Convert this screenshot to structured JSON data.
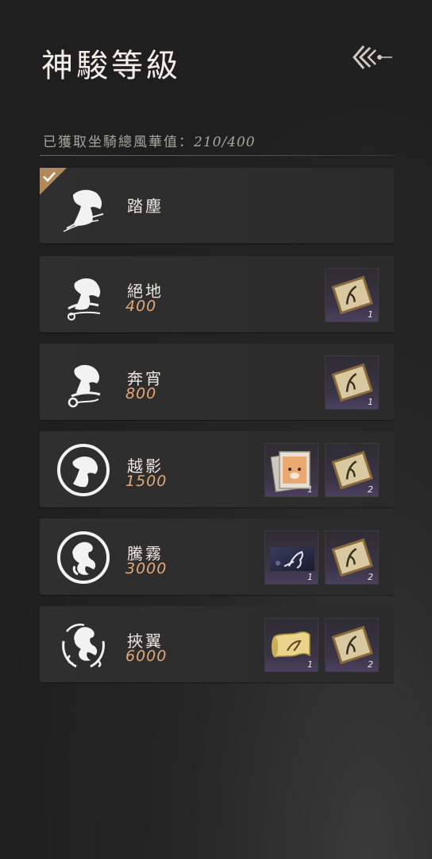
{
  "header": {
    "title": "神駿等級"
  },
  "progress": {
    "label": "已獲取坐騎總風華值：",
    "value": "210/400"
  },
  "levels": [
    {
      "name": "踏塵",
      "requirement": "",
      "achieved": true,
      "rewards": []
    },
    {
      "name": "絕地",
      "requirement": "400",
      "achieved": false,
      "rewards": [
        {
          "icon": "horse-scroll-icon",
          "count": "1"
        }
      ]
    },
    {
      "name": "奔宵",
      "requirement": "800",
      "achieved": false,
      "rewards": [
        {
          "icon": "horse-scroll-icon",
          "count": "1"
        }
      ]
    },
    {
      "name": "越影",
      "requirement": "1500",
      "achieved": false,
      "rewards": [
        {
          "icon": "fox-card-icon",
          "count": "1"
        },
        {
          "icon": "horse-scroll-icon",
          "count": "2"
        }
      ]
    },
    {
      "name": "騰霧",
      "requirement": "3000",
      "achieved": false,
      "rewards": [
        {
          "icon": "night-horse-picture-icon",
          "count": "1"
        },
        {
          "icon": "horse-scroll-icon",
          "count": "2"
        }
      ]
    },
    {
      "name": "挾翼",
      "requirement": "6000",
      "achieved": false,
      "rewards": [
        {
          "icon": "golden-scroll-icon",
          "count": "1"
        },
        {
          "icon": "horse-scroll-icon",
          "count": "2"
        }
      ]
    }
  ],
  "colors": {
    "requirement": "#e3a878",
    "check_badge": "#b08a5a"
  }
}
